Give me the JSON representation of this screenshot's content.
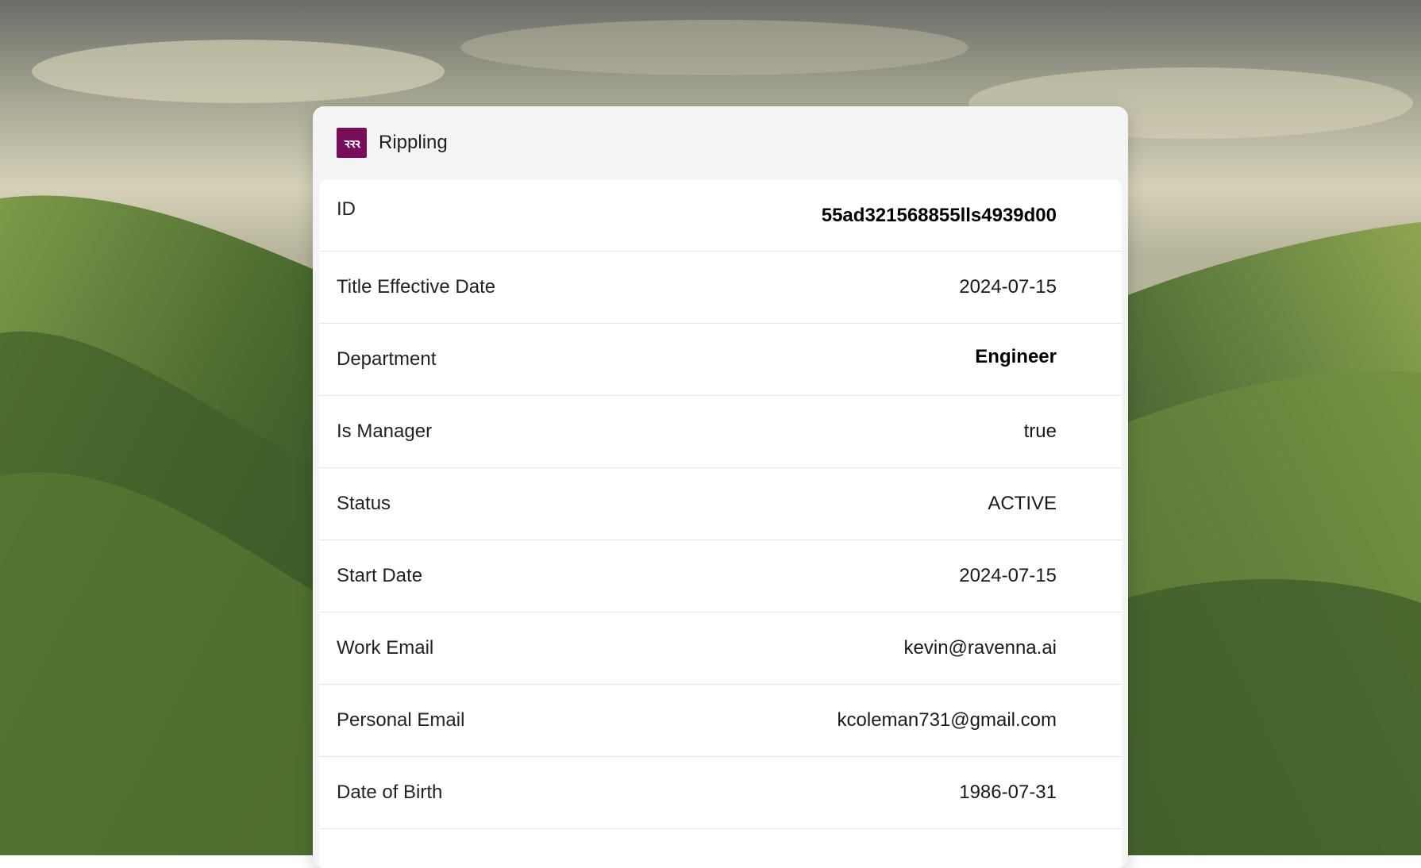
{
  "app": {
    "name": "Rippling",
    "logo_text": "ꝛꝛꝛ",
    "logo_color": "#7a0d5b"
  },
  "fields": [
    {
      "label": "ID",
      "value": "55ad321568855lls4939d00",
      "emphasis": true
    },
    {
      "label": "Title Effective Date",
      "value": "2024-07-15",
      "emphasis": false
    },
    {
      "label": "Department",
      "value": "Engineer",
      "emphasis": true
    },
    {
      "label": "Is Manager",
      "value": "true",
      "emphasis": false
    },
    {
      "label": "Status",
      "value": "ACTIVE",
      "emphasis": false
    },
    {
      "label": "Start Date",
      "value": "2024-07-15",
      "emphasis": false
    },
    {
      "label": "Work Email",
      "value": "kevin@ravenna.ai",
      "emphasis": false
    },
    {
      "label": "Personal Email",
      "value": "kcoleman731@gmail.com",
      "emphasis": false
    },
    {
      "label": "Date of Birth",
      "value": "1986-07-31",
      "emphasis": false
    }
  ]
}
